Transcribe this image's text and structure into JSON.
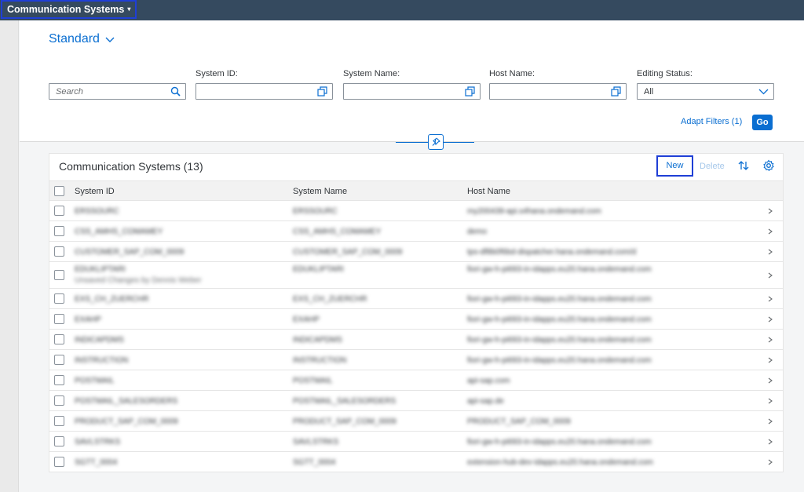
{
  "shell": {
    "app_title": "Communication Systems",
    "caret": "▾"
  },
  "variant": {
    "label": "Standard"
  },
  "filters": {
    "search": {
      "placeholder": "Search"
    },
    "system_id": {
      "label": "System ID:",
      "value": ""
    },
    "system_name": {
      "label": "System Name:",
      "value": ""
    },
    "host_name": {
      "label": "Host Name:",
      "value": ""
    },
    "editing_status": {
      "label": "Editing Status:",
      "value": "All"
    }
  },
  "filter_bar": {
    "adapt_filters": "Adapt Filters (1)",
    "go": "Go"
  },
  "table": {
    "title": "Communication Systems (13)",
    "actions": {
      "new": "New",
      "delete": "Delete"
    },
    "columns": {
      "system_id": "System ID",
      "system_name": "System Name",
      "host_name": "Host Name"
    },
    "rows": [
      {
        "id": "ERSSOURC",
        "name": "ERSSOURC",
        "host": "my200439-api.s4hana.ondemand.com",
        "sub": ""
      },
      {
        "id": "CSS_AMHS_COMAMEY",
        "name": "CSS_AMHS_COMAMEY",
        "host": "demo",
        "sub": ""
      },
      {
        "id": "CUSTOMER_SAP_COM_0009",
        "name": "CUSTOMER_SAP_COM_0009",
        "host": "tps-df8b0f6bd-dispatcher.hana.ondemand.com/d",
        "sub": ""
      },
      {
        "id": "EDUKLIPTARI",
        "name": "EDUKLIPTARI",
        "host": "fiori-gw-h-pi693-in-idapps.eu20.hana.ondemand.com",
        "sub": "Unsaved Changes by Dennis Weber"
      },
      {
        "id": "EXS_CH_ZUERCHR",
        "name": "EXS_CH_ZUERCHR",
        "host": "fiori-gw-h-pi693-in-idapps.eu20.hana.ondemand.com",
        "sub": ""
      },
      {
        "id": "EXAHP",
        "name": "EXAHP",
        "host": "fiori-gw-h-pi693-in-idapps.eu20.hana.ondemand.com",
        "sub": ""
      },
      {
        "id": "INDICAPDMS",
        "name": "INDICAPDMS",
        "host": "fiori-gw-h-pi693-in-idapps.eu20.hana.ondemand.com",
        "sub": ""
      },
      {
        "id": "INSTRUCTION",
        "name": "INSTRUCTION",
        "host": "fiori-gw-h-pi693-in-idapps.eu20.hana.ondemand.com",
        "sub": ""
      },
      {
        "id": "POSTMAIL",
        "name": "POSTMAIL",
        "host": "api-sap.com",
        "sub": ""
      },
      {
        "id": "POSTMAIL_SALESORDERS",
        "name": "POSTMAIL_SALESORDERS",
        "host": "api-sap.de",
        "sub": ""
      },
      {
        "id": "PRODUCT_SAP_COM_0009",
        "name": "PRODUCT_SAP_COM_0009",
        "host": "PRODUCT_SAP_COM_0009",
        "sub": ""
      },
      {
        "id": "SAVLSTRKS",
        "name": "SAVLSTRKS",
        "host": "fiori-gw-h-pi693-in-idapps.eu20.hana.ondemand.com",
        "sub": ""
      },
      {
        "id": "SGTT_0004",
        "name": "SGTT_0004",
        "host": "extension-hub-dev-idapps.eu20.hana.ondemand.com",
        "sub": ""
      }
    ]
  },
  "colors": {
    "shell": "#354a5f",
    "accent": "#0a6ed1",
    "highlight_border": "#1f3fd6"
  }
}
